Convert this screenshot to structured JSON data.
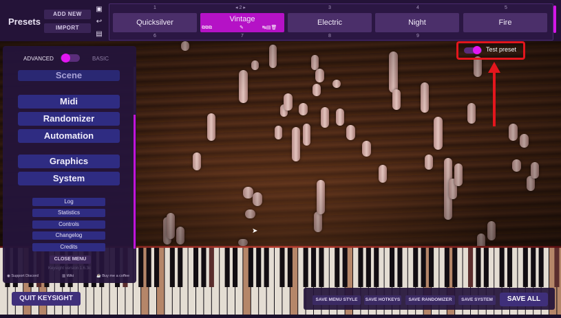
{
  "header": {
    "title": "Presets",
    "add_new_label": "ADD NEW",
    "import_label": "IMPORT",
    "page_indicator": "2",
    "tabs": [
      {
        "num": "1",
        "label": "Quicksilver"
      },
      {
        "num": "2",
        "label": "Vintage"
      },
      {
        "num": "3",
        "label": "Electric"
      },
      {
        "num": "4",
        "label": "Night"
      },
      {
        "num": "5",
        "label": "Fire"
      }
    ],
    "next_row_nums": [
      "6",
      "7",
      "8",
      "9"
    ]
  },
  "test_preset": {
    "label": "Test preset",
    "enabled": true
  },
  "menu": {
    "advanced_label": "ADVANCED",
    "basic_label": "BASIC",
    "main_items": [
      "Scene",
      "Midi",
      "Randomizer",
      "Automation",
      "Graphics",
      "System"
    ],
    "sub_items": [
      "Log",
      "Statistics",
      "Controls",
      "Changelog",
      "Credits"
    ],
    "close_label": "CLOSE MENU",
    "version": "Keysight version 1.6.3c",
    "support_discord": "Support Discord",
    "wiki": "Wiki",
    "buy_coffee": "Buy me a coffee"
  },
  "bottom": {
    "quit_label": "QUIT KEYSIGHT",
    "save_menu_style": "SAVE MENU STYLE",
    "save_hotkeys": "SAVE HOTKEYS",
    "save_randomizer": "SAVE RANDOMIZER",
    "save_system": "SAVE SYSTEM",
    "save_all": "SAVE ALL"
  },
  "colors": {
    "accent": "#b512c6",
    "highlight_red": "#e3161d",
    "menu_button": "#2f2c82"
  }
}
